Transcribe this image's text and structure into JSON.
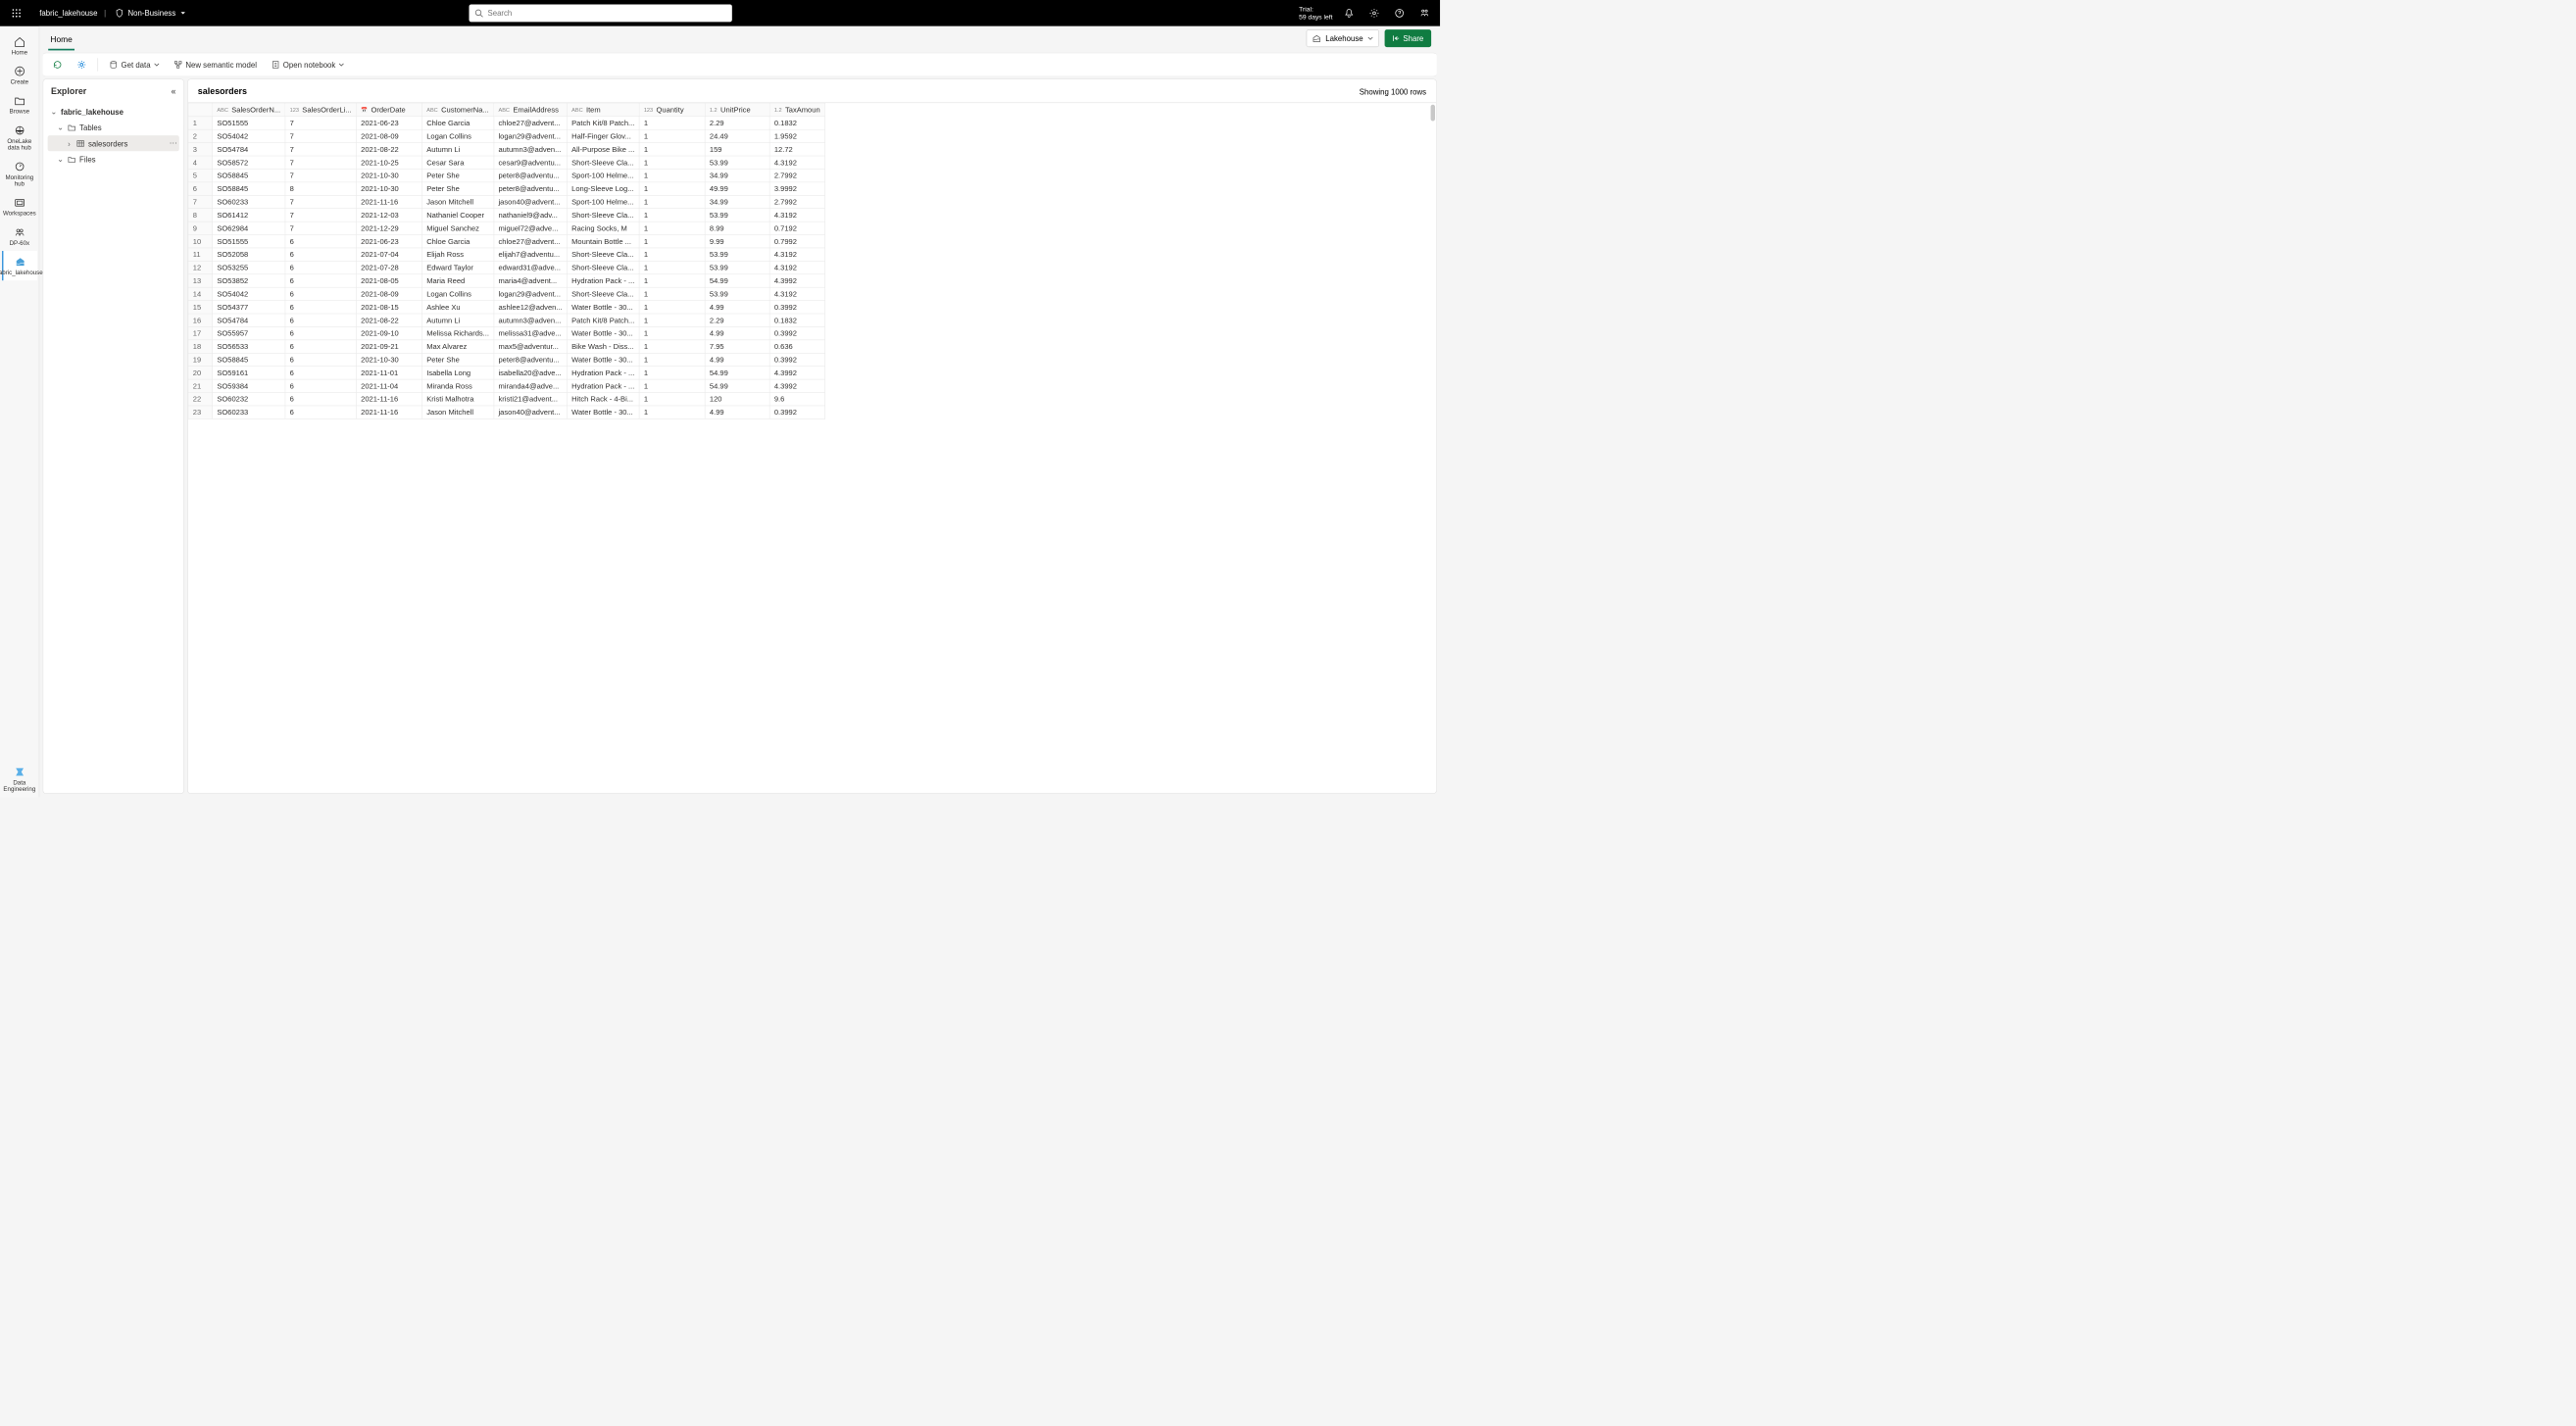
{
  "topbar": {
    "breadcrumb": "fabric_lakehouse",
    "sensitivity": "Non-Business",
    "search_placeholder": "Search",
    "trial_label": "Trial:",
    "trial_remaining": "59 days left"
  },
  "rail": {
    "items": [
      {
        "label": "Home",
        "icon": "home"
      },
      {
        "label": "Create",
        "icon": "plus-circle"
      },
      {
        "label": "Browse",
        "icon": "folder"
      },
      {
        "label": "OneLake data hub",
        "icon": "onelake"
      },
      {
        "label": "Monitoring hub",
        "icon": "monitor"
      },
      {
        "label": "Workspaces",
        "icon": "workspaces"
      },
      {
        "label": "DP-60x",
        "icon": "group"
      },
      {
        "label": "fabric_lakehouse",
        "icon": "lakehouse",
        "active": true
      }
    ],
    "footer": {
      "label": "Data Engineering",
      "icon": "data-eng"
    }
  },
  "tabs": {
    "home": "Home"
  },
  "mode_button": "Lakehouse",
  "share_button": "Share",
  "toolbar": {
    "get_data": "Get data",
    "semantic_model": "New semantic model",
    "open_notebook": "Open notebook"
  },
  "explorer": {
    "title": "Explorer",
    "root": "fabric_lakehouse",
    "tables_label": "Tables",
    "table_name": "salesorders",
    "files_label": "Files"
  },
  "main": {
    "title": "salesorders",
    "row_count_label": "Showing 1000 rows",
    "columns": [
      {
        "name": "SalesOrderN...",
        "type": "ABC",
        "w": 112
      },
      {
        "name": "SalesOrderLi...",
        "type": "123",
        "w": 118
      },
      {
        "name": "OrderDate",
        "type": "date",
        "w": 120
      },
      {
        "name": "CustomerNa...",
        "type": "ABC",
        "w": 120
      },
      {
        "name": "EmailAddress",
        "type": "ABC",
        "w": 120
      },
      {
        "name": "Item",
        "type": "ABC",
        "w": 118
      },
      {
        "name": "Quantity",
        "type": "123",
        "w": 120
      },
      {
        "name": "UnitPrice",
        "type": "1.2",
        "w": 118
      },
      {
        "name": "TaxAmoun",
        "type": "1.2",
        "w": 90
      }
    ],
    "rows": [
      [
        "SO51555",
        "7",
        "2021-06-23",
        "Chloe Garcia",
        "chloe27@advent...",
        "Patch Kit/8 Patch...",
        "1",
        "2.29",
        "0.1832"
      ],
      [
        "SO54042",
        "7",
        "2021-08-09",
        "Logan Collins",
        "logan29@advent...",
        "Half-Finger Glov...",
        "1",
        "24.49",
        "1.9592"
      ],
      [
        "SO54784",
        "7",
        "2021-08-22",
        "Autumn Li",
        "autumn3@adven...",
        "All-Purpose Bike ...",
        "1",
        "159",
        "12.72"
      ],
      [
        "SO58572",
        "7",
        "2021-10-25",
        "Cesar Sara",
        "cesar9@adventu...",
        "Short-Sleeve Cla...",
        "1",
        "53.99",
        "4.3192"
      ],
      [
        "SO58845",
        "7",
        "2021-10-30",
        "Peter She",
        "peter8@adventu...",
        "Sport-100 Helme...",
        "1",
        "34.99",
        "2.7992"
      ],
      [
        "SO58845",
        "8",
        "2021-10-30",
        "Peter She",
        "peter8@adventu...",
        "Long-Sleeve Log...",
        "1",
        "49.99",
        "3.9992"
      ],
      [
        "SO60233",
        "7",
        "2021-11-16",
        "Jason Mitchell",
        "jason40@advent...",
        "Sport-100 Helme...",
        "1",
        "34.99",
        "2.7992"
      ],
      [
        "SO61412",
        "7",
        "2021-12-03",
        "Nathaniel Cooper",
        "nathaniel9@adv...",
        "Short-Sleeve Cla...",
        "1",
        "53.99",
        "4.3192"
      ],
      [
        "SO62984",
        "7",
        "2021-12-29",
        "Miguel Sanchez",
        "miguel72@adve...",
        "Racing Socks, M",
        "1",
        "8.99",
        "0.7192"
      ],
      [
        "SO51555",
        "6",
        "2021-06-23",
        "Chloe Garcia",
        "chloe27@advent...",
        "Mountain Bottle ...",
        "1",
        "9.99",
        "0.7992"
      ],
      [
        "SO52058",
        "6",
        "2021-07-04",
        "Elijah Ross",
        "elijah7@adventu...",
        "Short-Sleeve Cla...",
        "1",
        "53.99",
        "4.3192"
      ],
      [
        "SO53255",
        "6",
        "2021-07-28",
        "Edward Taylor",
        "edward31@adve...",
        "Short-Sleeve Cla...",
        "1",
        "53.99",
        "4.3192"
      ],
      [
        "SO53852",
        "6",
        "2021-08-05",
        "Maria Reed",
        "maria4@advent...",
        "Hydration Pack - ...",
        "1",
        "54.99",
        "4.3992"
      ],
      [
        "SO54042",
        "6",
        "2021-08-09",
        "Logan Collins",
        "logan29@advent...",
        "Short-Sleeve Cla...",
        "1",
        "53.99",
        "4.3192"
      ],
      [
        "SO54377",
        "6",
        "2021-08-15",
        "Ashlee Xu",
        "ashlee12@adven...",
        "Water Bottle - 30...",
        "1",
        "4.99",
        "0.3992"
      ],
      [
        "SO54784",
        "6",
        "2021-08-22",
        "Autumn Li",
        "autumn3@adven...",
        "Patch Kit/8 Patch...",
        "1",
        "2.29",
        "0.1832"
      ],
      [
        "SO55957",
        "6",
        "2021-09-10",
        "Melissa Richards...",
        "melissa31@adve...",
        "Water Bottle - 30...",
        "1",
        "4.99",
        "0.3992"
      ],
      [
        "SO56533",
        "6",
        "2021-09-21",
        "Max Alvarez",
        "max5@adventur...",
        "Bike Wash - Diss...",
        "1",
        "7.95",
        "0.636"
      ],
      [
        "SO58845",
        "6",
        "2021-10-30",
        "Peter She",
        "peter8@adventu...",
        "Water Bottle - 30...",
        "1",
        "4.99",
        "0.3992"
      ],
      [
        "SO59161",
        "6",
        "2021-11-01",
        "Isabella Long",
        "isabella20@adve...",
        "Hydration Pack - ...",
        "1",
        "54.99",
        "4.3992"
      ],
      [
        "SO59384",
        "6",
        "2021-11-04",
        "Miranda Ross",
        "miranda4@adve...",
        "Hydration Pack - ...",
        "1",
        "54.99",
        "4.3992"
      ],
      [
        "SO60232",
        "6",
        "2021-11-16",
        "Kristi Malhotra",
        "kristi21@advent...",
        "Hitch Rack - 4-Bi...",
        "1",
        "120",
        "9.6"
      ],
      [
        "SO60233",
        "6",
        "2021-11-16",
        "Jason Mitchell",
        "jason40@advent...",
        "Water Bottle - 30...",
        "1",
        "4.99",
        "0.3992"
      ]
    ]
  }
}
